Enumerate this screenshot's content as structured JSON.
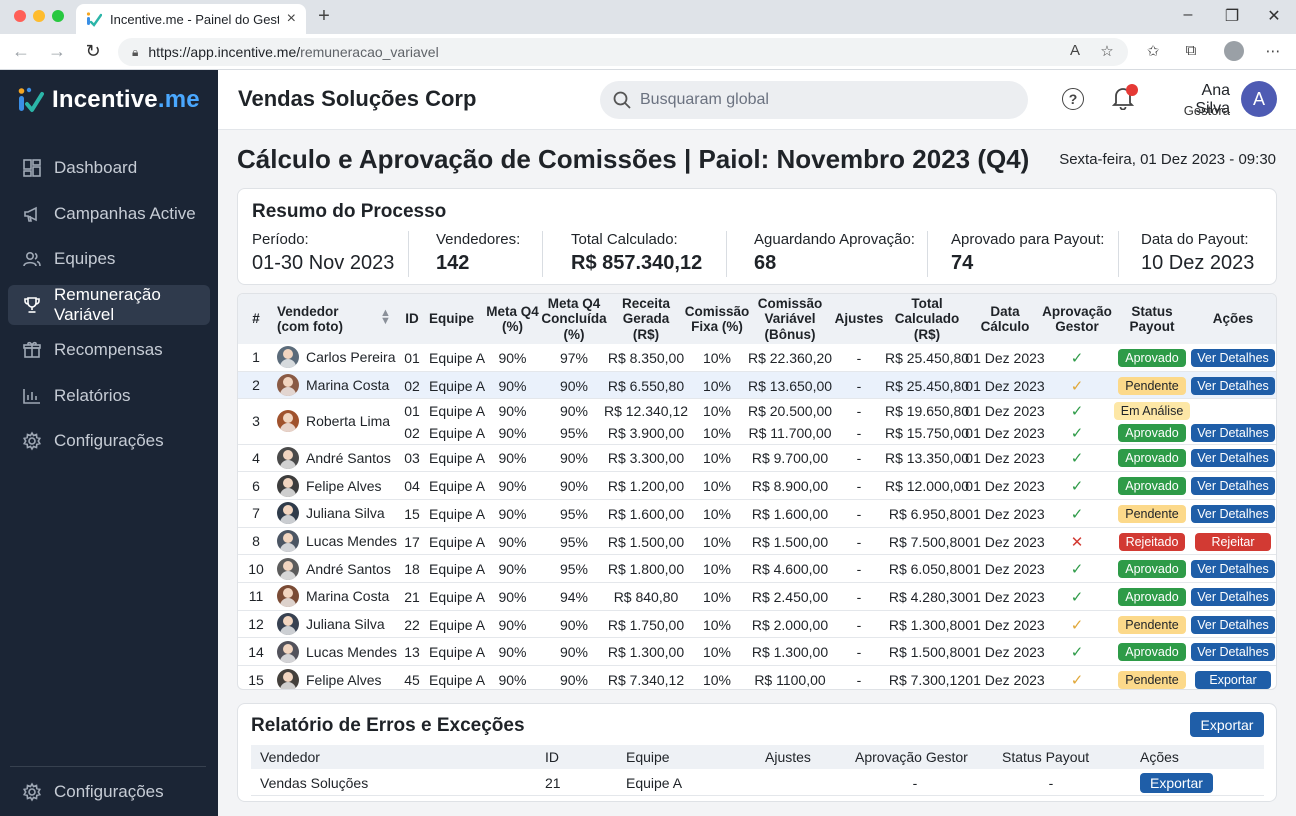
{
  "browser": {
    "tab_title": "Incentive.me - Painel do Gestor",
    "url_host": "https://app.incentive.me/",
    "url_path": "remuneracao_variavel"
  },
  "sidebar": {
    "logo_main": "Incentive",
    "logo_accent": ".me",
    "items": [
      {
        "label": "Dashboard",
        "icon": "dashboard-icon",
        "active": false
      },
      {
        "label": "Campanhas Active",
        "icon": "megaphone-icon",
        "active": false
      },
      {
        "label": "Equipes",
        "icon": "users-icon",
        "active": false
      },
      {
        "label": "Remuneração Variável",
        "icon": "trophy-icon",
        "active": true
      },
      {
        "label": "Recompensas",
        "icon": "gift-icon",
        "active": false
      },
      {
        "label": "Relatórios",
        "icon": "bar-chart-icon",
        "active": false
      },
      {
        "label": "Configurações",
        "icon": "gear-icon",
        "active": false
      }
    ],
    "bottom_label": "Configurações"
  },
  "header": {
    "company": "Vendas Soluções Corp",
    "search_placeholder": "Busquaram global",
    "user_name": "Ana Silva",
    "user_role": "Gestora",
    "user_initial": "A"
  },
  "page": {
    "title": "Cálculo e Aprovação de Comissões | Paiol: Novembro 2023 (Q4)",
    "date": "Sexta-feira, 01 Dez 2023 - 09:30"
  },
  "summary": {
    "title": "Resumo do Processo",
    "stats": [
      {
        "label": "Período:",
        "value": "01-30 Nov 2023"
      },
      {
        "label": "Vendedores:",
        "value": "142"
      },
      {
        "label": "Total Calculado:",
        "value": "R$ 857.340,12"
      },
      {
        "label": "Aguardando Aprovação:",
        "value": "68"
      },
      {
        "label": "Aprovado para Payout:",
        "value": "74"
      },
      {
        "label": "Data do Payout:",
        "value": "10 Dez 2023"
      }
    ]
  },
  "table": {
    "headers": {
      "num": "#",
      "vendedor": "Vendedor\n(com foto)",
      "id": "ID",
      "equipe": "Equipe",
      "meta": "Meta Q4\n(%)",
      "concluida": "Meta Q4\nConcluída\n(%)",
      "receita": "Receita\nGerada\n(R$)",
      "fixa": "Comissão\nFixa (%)",
      "variavel": "Comissão\nVariável\n(Bônus)",
      "ajustes": "Ajustes",
      "total": "Total\nCalculado\n(R$)",
      "data": "Data\nCálculo",
      "aprovacao": "Aprovação\nGestor",
      "status": "Status\nPayout",
      "acoes": "Ações"
    },
    "rows": [
      {
        "num": "1",
        "name": "Carlos Pereira",
        "avatar": "#5b6b7a",
        "subs": [
          {
            "id": "01",
            "team": "Equipe A",
            "meta": "90%",
            "conc": "97%",
            "receita": "R$ 8.350,00",
            "fixa": "10%",
            "var": "R$ 22.360,20",
            "aj": "-",
            "total": "R$ 25.450,80",
            "data": "01 Dez 2023",
            "approval": "ok",
            "status": "Aprovado",
            "action": "Ver Detalhes"
          }
        ]
      },
      {
        "num": "2",
        "name": "Marina Costa",
        "avatar": "#8a5a44",
        "hl": true,
        "subs": [
          {
            "id": "02",
            "team": "Equipe A",
            "meta": "90%",
            "conc": "90%",
            "receita": "R$ 6.550,80",
            "fixa": "10%",
            "var": "R$ 13.650,00",
            "aj": "-",
            "total": "R$ 25.450,80",
            "data": "01 Dez 2023",
            "approval": "pending",
            "status": "Pendente",
            "action": "Ver Detalhes"
          }
        ]
      },
      {
        "num": "3",
        "name": "Roberta Lima",
        "avatar": "#a0522d",
        "subs": [
          {
            "id": "01",
            "team": "Equipe A",
            "meta": "90%",
            "conc": "90%",
            "receita": "R$ 12.340,12",
            "fixa": "10%",
            "var": "R$ 20.500,00",
            "aj": "-",
            "total": "R$ 19.650,80",
            "data": "01 Dez 2023",
            "approval": "ok",
            "status": "Em Análise",
            "action": ""
          },
          {
            "id": "02",
            "team": "Equipe A",
            "meta": "90%",
            "conc": "95%",
            "receita": "R$ 3.900,00",
            "fixa": "10%",
            "var": "R$ 11.700,00",
            "aj": "-",
            "total": "R$ 15.750,00",
            "data": "01 Dez 2023",
            "approval": "ok",
            "status": "Aprovado",
            "action": "Ver Detalhes"
          }
        ]
      },
      {
        "num": "4",
        "name": "André Santos",
        "avatar": "#4a4a4a",
        "subs": [
          {
            "id": "03",
            "team": "Equipe A",
            "meta": "90%",
            "conc": "90%",
            "receita": "R$ 3.300,00",
            "fixa": "10%",
            "var": "R$ 9.700,00",
            "aj": "-",
            "total": "R$ 13.350,00",
            "data": "01 Dez 2023",
            "approval": "ok",
            "status": "Aprovado",
            "action": "Ver Detalhes"
          }
        ]
      },
      {
        "num": "6",
        "name": "Felipe Alves",
        "avatar": "#3d3d3d",
        "subs": [
          {
            "id": "04",
            "team": "Equipe A",
            "meta": "90%",
            "conc": "90%",
            "receita": "R$ 1.200,00",
            "fixa": "10%",
            "var": "R$ 8.900,00",
            "aj": "-",
            "total": "R$ 12.000,00",
            "data": "01 Dez 2023",
            "approval": "ok",
            "status": "Aprovado",
            "action": "Ver Detalhes"
          }
        ]
      },
      {
        "num": "7",
        "name": "Juliana Silva",
        "avatar": "#2f3b4a",
        "subs": [
          {
            "id": "15",
            "team": "Equipe A",
            "meta": "90%",
            "conc": "95%",
            "receita": "R$ 1.600,00",
            "fixa": "10%",
            "var": "R$ 1.600,00",
            "aj": "-",
            "total": "R$ 6.950,80",
            "data": "01 Dez 2023",
            "approval": "ok",
            "status": "Pendente",
            "action": "Ver Detalhes"
          }
        ]
      },
      {
        "num": "8",
        "name": "Lucas Mendes",
        "avatar": "#4b5563",
        "subs": [
          {
            "id": "17",
            "team": "Equipe A",
            "meta": "90%",
            "conc": "95%",
            "receita": "R$ 1.500,00",
            "fixa": "10%",
            "var": "R$ 1.500,00",
            "aj": "-",
            "total": "R$ 7.500,80",
            "data": "01 Dez 2023",
            "approval": "reject",
            "status": "Rejeitado",
            "action": "Rejeitar"
          }
        ]
      },
      {
        "num": "10",
        "name": "André Santos",
        "avatar": "#5c5c5c",
        "subs": [
          {
            "id": "18",
            "team": "Equipe A",
            "meta": "90%",
            "conc": "95%",
            "receita": "R$ 1.800,00",
            "fixa": "10%",
            "var": "R$ 4.600,00",
            "aj": "-",
            "total": "R$ 6.050,80",
            "data": "01 Dez 2023",
            "approval": "ok",
            "status": "Aprovado",
            "action": "Ver Detalhes"
          }
        ]
      },
      {
        "num": "11",
        "name": "Marina Costa",
        "avatar": "#7a4b35",
        "subs": [
          {
            "id": "21",
            "team": "Equipe A",
            "meta": "90%",
            "conc": "94%",
            "receita": "R$ 840,80",
            "fixa": "10%",
            "var": "R$ 2.450,00",
            "aj": "-",
            "total": "R$ 4.280,30",
            "data": "01 Dez 2023",
            "approval": "ok",
            "status": "Aprovado",
            "action": "Ver Detalhes"
          }
        ]
      },
      {
        "num": "12",
        "name": "Juliana Silva",
        "avatar": "#374151",
        "subs": [
          {
            "id": "22",
            "team": "Equipe A",
            "meta": "90%",
            "conc": "90%",
            "receita": "R$ 1.750,00",
            "fixa": "10%",
            "var": "R$ 2.000,00",
            "aj": "-",
            "total": "R$ 1.300,80",
            "data": "01 Dez 2023",
            "approval": "pending",
            "status": "Pendente",
            "action": "Ver Detalhes"
          }
        ]
      },
      {
        "num": "14",
        "name": "Lucas Mendes",
        "avatar": "#52525b",
        "subs": [
          {
            "id": "13",
            "team": "Equipe A",
            "meta": "90%",
            "conc": "90%",
            "receita": "R$ 1.300,00",
            "fixa": "10%",
            "var": "R$ 1.300,00",
            "aj": "-",
            "total": "R$ 1.500,80",
            "data": "01 Dez 2023",
            "approval": "ok",
            "status": "Aprovado",
            "action": "Ver Detalhes"
          }
        ]
      },
      {
        "num": "15",
        "name": "Felipe Alves",
        "avatar": "#44403c",
        "subs": [
          {
            "id": "45",
            "team": "Equipe A",
            "meta": "90%",
            "conc": "90%",
            "receita": "R$ 7.340,12",
            "fixa": "10%",
            "var": "R$ 1100,00",
            "aj": "-",
            "total": "R$ 7.300,12",
            "data": "01 Dez 2023",
            "approval": "pending",
            "status": "Pendente",
            "action": "Exportar"
          }
        ]
      }
    ]
  },
  "status_colors": {
    "Aprovado": {
      "bg": "#2e9b48",
      "fg": "#ffffff"
    },
    "Pendente": {
      "bg": "#fcd98a",
      "fg": "#1f2328"
    },
    "Em Análise": {
      "bg": "#fde7a6",
      "fg": "#1f2328"
    },
    "Rejeitado": {
      "bg": "#d23a33",
      "fg": "#ffffff"
    }
  },
  "action_colors": {
    "Ver Detalhes": "#1f5ea8",
    "Rejeitar": "#d23a33",
    "Exportar": "#1f5ea8"
  },
  "approval_marks": {
    "ok": {
      "glyph": "✓",
      "color": "#2e9b48"
    },
    "pending": {
      "glyph": "✓",
      "color": "#e0a83a"
    },
    "reject": {
      "glyph": "✕",
      "color": "#d23a33"
    }
  },
  "errors": {
    "title": "Relatório de Erros e Exceções",
    "export_label": "Exportar",
    "headers": [
      "Vendedor",
      "ID",
      "Equipe",
      "Ajustes",
      "Aprovação Gestor",
      "Status Payout",
      "Ações"
    ],
    "row": {
      "vendedor": "Vendas Soluções",
      "id": "21",
      "equipe": "Equipe A",
      "ajustes": "",
      "aprovacao": "-",
      "status": "-",
      "acao": "Exportar"
    }
  }
}
